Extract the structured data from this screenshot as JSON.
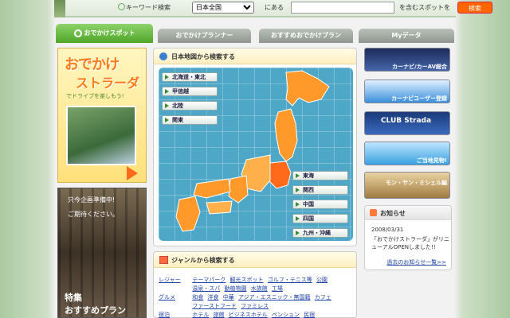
{
  "search": {
    "keyword_label": "キーワード検索",
    "region_selected": "日本全国",
    "at_label": "にある",
    "query_value": "",
    "containing_label": "を含むスポットを",
    "button_label": "検索"
  },
  "tabs": [
    {
      "label": "おでかけスポット"
    },
    {
      "label": "おでかけプランナー"
    },
    {
      "label": "おすすめおでかけプラン"
    },
    {
      "label": "Myデータ"
    }
  ],
  "promo_left": {
    "title_line1": "おでかけ",
    "title_line2": "ストラーダ",
    "tagline": "でドライブを楽しもう!",
    "notice_line1": "只今企画準備中!",
    "notice_line2": "ご期待ください。",
    "feature_line1": "特集",
    "feature_line2": "おすすめプラン"
  },
  "map_panel": {
    "title": "日本地図から検索する",
    "regions_left": [
      "北海道・東北",
      "甲信越",
      "北陸",
      "関東"
    ],
    "regions_right": [
      "東海",
      "関西",
      "中国",
      "四国",
      "九州・沖縄"
    ]
  },
  "genre_panel": {
    "title": "ジャンルから検索する",
    "rows": [
      {
        "category": "レジャー",
        "items": [
          "テーマパーク",
          "観光スポット",
          "ゴルフ・テニス等",
          "公園"
        ]
      },
      {
        "category": "",
        "items": [
          "温泉・スパ",
          "動植物園",
          "水族館",
          "工場"
        ]
      },
      {
        "category": "グルメ",
        "items": [
          "和食",
          "洋食",
          "中華",
          "アジア・エスニック・無国籍",
          "カフェ"
        ]
      },
      {
        "category": "",
        "items": [
          "ファーストフード",
          "ファミレス"
        ]
      },
      {
        "category": "宿泊",
        "items": [
          "ホテル",
          "旅館",
          "ビジネスホテル",
          "ペンション",
          "民宿"
        ]
      }
    ]
  },
  "banners": [
    {
      "label": "カーナビ/カーAV総合"
    },
    {
      "label": "カーナビユーザー登録"
    },
    {
      "label": "CLUB Strada"
    },
    {
      "label": "ご当地見物!"
    },
    {
      "label": "モン・サン・ミシェル編"
    }
  ],
  "news": {
    "title": "お知らせ",
    "date": "2008/03/31",
    "text": "「おでかけストラーダ」がリニューアルOPENしました!!",
    "more_link": "過去のお知らせ一覧>>"
  },
  "colors": {
    "accent_orange": "#ff7a1a",
    "map_sea": "#4fa7c8",
    "map_land": "#ff9a2a",
    "tab_active": "#4ea627"
  }
}
